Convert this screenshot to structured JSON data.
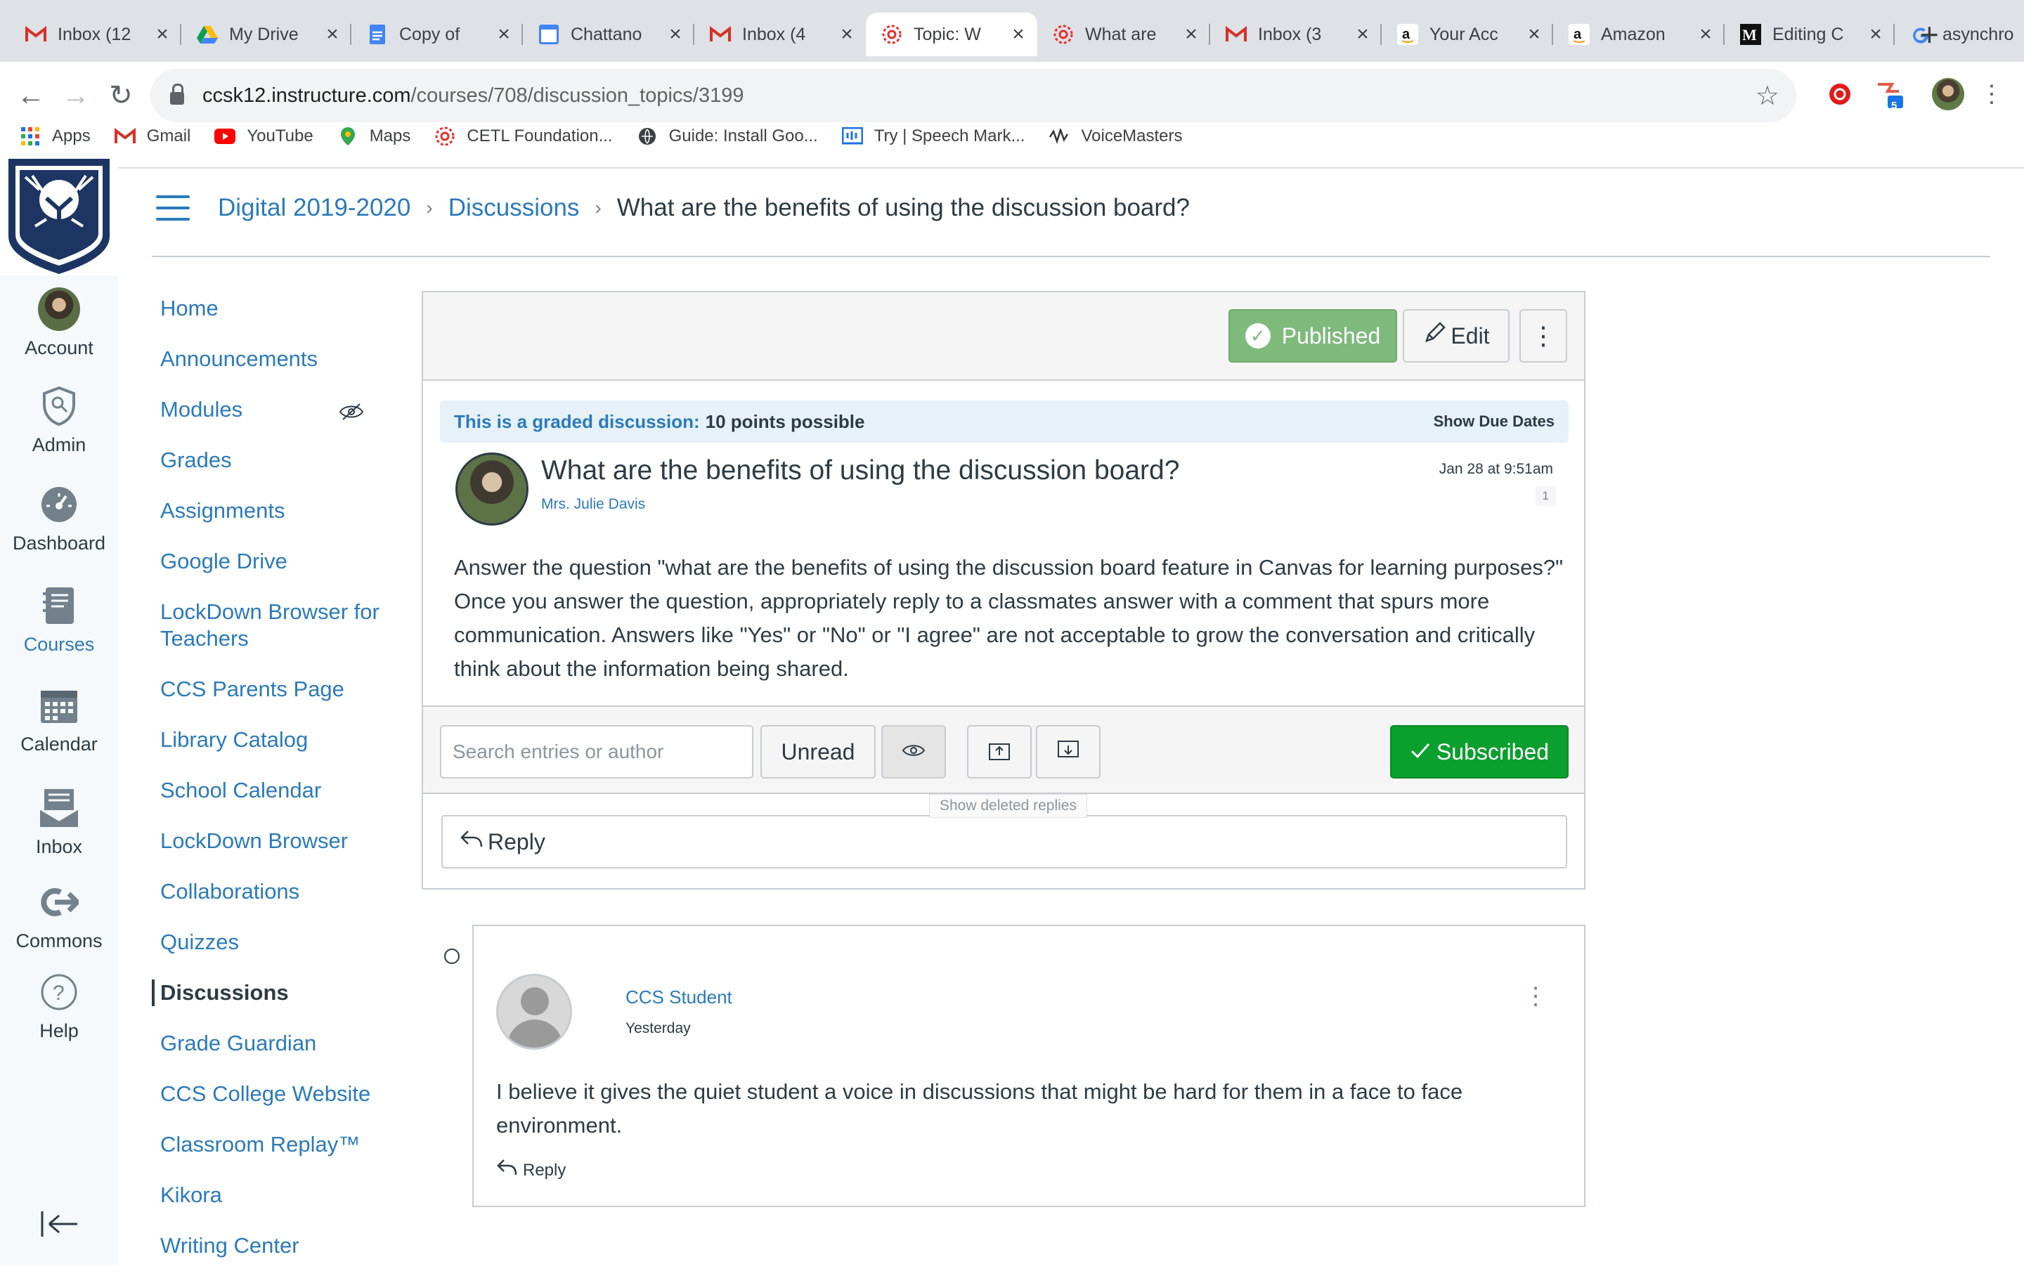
{
  "browser": {
    "tabs": [
      {
        "title": "Inbox (12",
        "icon": "gmail-icon"
      },
      {
        "title": "My Drive",
        "icon": "drive-icon"
      },
      {
        "title": "Copy of",
        "icon": "docs-icon"
      },
      {
        "title": "Chattano",
        "icon": "calendar-icon",
        "badge": "29"
      },
      {
        "title": "Inbox (4",
        "icon": "gmail-icon"
      },
      {
        "title": "Topic: W",
        "icon": "canvas-icon"
      },
      {
        "title": "What are",
        "icon": "canvas-icon"
      },
      {
        "title": "Inbox (3",
        "icon": "gmail-icon"
      },
      {
        "title": "Your Acc",
        "icon": "amazon-icon"
      },
      {
        "title": "Amazon",
        "icon": "amazon-icon"
      },
      {
        "title": "Editing C",
        "icon": "medium-icon"
      },
      {
        "title": "asynchro",
        "icon": "google-icon"
      }
    ],
    "url_host": "ccsk12.instructure.com",
    "url_path": "/courses/708/discussion_topics/3199",
    "extension_badge": "5",
    "bookmarks": [
      {
        "label": "Apps"
      },
      {
        "label": "Gmail"
      },
      {
        "label": "YouTube"
      },
      {
        "label": "Maps"
      },
      {
        "label": "CETL Foundation..."
      },
      {
        "label": "Guide: Install Goo..."
      },
      {
        "label": "Try | Speech Mark..."
      },
      {
        "label": "VoiceMasters"
      }
    ]
  },
  "global_nav": {
    "items": [
      {
        "label": "Account",
        "icon": "avatar-icon"
      },
      {
        "label": "Admin",
        "icon": "shield-icon"
      },
      {
        "label": "Dashboard",
        "icon": "dashboard-icon"
      },
      {
        "label": "Courses",
        "icon": "book-icon"
      },
      {
        "label": "Calendar",
        "icon": "calendar-icon"
      },
      {
        "label": "Inbox",
        "icon": "inbox-icon"
      },
      {
        "label": "Commons",
        "icon": "commons-icon"
      },
      {
        "label": "Help",
        "icon": "help-icon"
      }
    ]
  },
  "breadcrumb": {
    "course": "Digital 2019-2020",
    "section": "Discussions",
    "current": "What are the benefits of using the discussion board?"
  },
  "course_nav": {
    "items": [
      "Home",
      "Announcements",
      "Modules",
      "Grades",
      "Assignments",
      "Google Drive",
      "LockDown Browser for Teachers",
      "CCS Parents Page",
      "Library Catalog",
      "School Calendar",
      "LockDown Browser",
      "Collaborations",
      "Quizzes",
      "Discussions",
      "Grade Guardian",
      "CCS College Website",
      "Classroom Replay™",
      "Kikora",
      "Writing Center"
    ],
    "active": "Discussions"
  },
  "discussion": {
    "published_label": "Published",
    "edit_label": "Edit",
    "graded_label": "This is a graded discussion:",
    "points": "10 points possible",
    "show_due_dates": "Show Due Dates",
    "title": "What are the benefits of using the discussion board?",
    "author": "Mrs. Julie Davis",
    "date": "Jan 28 at 9:51am",
    "count": "1",
    "body": "Answer the question \"what are the benefits of using the discussion board feature in Canvas for learning purposes?\" Once you answer the question, appropriately reply to a classmates answer with a comment that spurs more communication. Answers like \"Yes\" or \"No\" or \"I agree\" are not acceptable to grow the conversation and critically think about the information being shared.",
    "search_placeholder": "Search entries or author",
    "unread_label": "Unread",
    "tooltip": "Show deleted replies",
    "subscribed_label": "Subscribed",
    "reply_label": "Reply"
  },
  "entry": {
    "author": "CCS Student",
    "date": "Yesterday",
    "body": "I believe it gives the quiet student a voice in discussions that might be hard for them in a face to face environment.",
    "reply_label": "Reply"
  },
  "colors": {
    "link": "#2b7abc",
    "published": "#7fba7d",
    "subscribed": "#0b9f2e",
    "graded_bg": "#e6f1fa"
  }
}
